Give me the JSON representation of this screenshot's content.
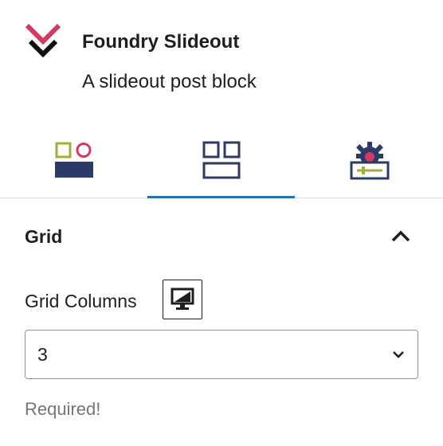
{
  "block": {
    "icon": "double-chevron-down-icon",
    "title": "Foundry Slideout",
    "description": "A slideout post block"
  },
  "tabs": [
    {
      "name": "style",
      "icon": "shapes-icon",
      "active": false
    },
    {
      "name": "layout",
      "icon": "grid-layout-icon",
      "active": true
    },
    {
      "name": "advanced",
      "icon": "gear-settings-icon",
      "active": false
    }
  ],
  "panel": {
    "title": "Grid",
    "expanded": true
  },
  "field": {
    "label": "Grid Columns",
    "device_icon": "desktop-icon",
    "value": "3",
    "help": "Required!"
  },
  "colors": {
    "accent": "#2271b1",
    "brand_red": "#d63864",
    "navy": "#2b3a67",
    "olive": "#a3ad3a"
  }
}
